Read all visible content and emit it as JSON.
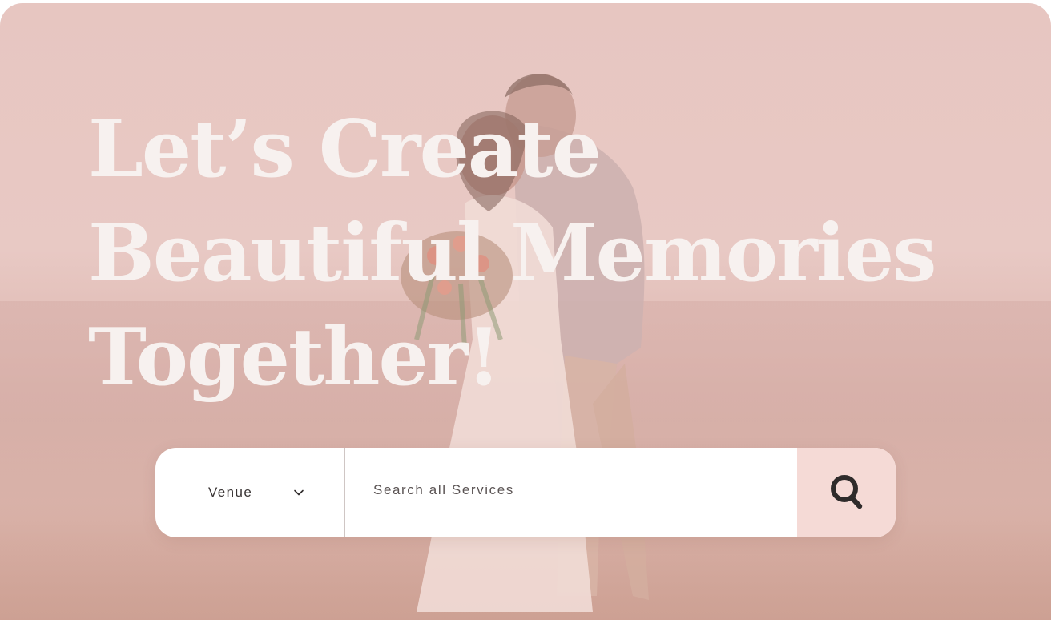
{
  "hero": {
    "headline_lines": [
      "Let’s Create",
      "Beautiful Memories",
      "Together!"
    ]
  },
  "search": {
    "category_value": "Venue",
    "placeholder": "Search all Services",
    "icons": {
      "dropdown": "chevron-down-icon",
      "submit": "search-icon"
    }
  },
  "colors": {
    "overlay_pink": "#e7c6c1",
    "headline_text": "#f7f1ef",
    "search_button_bg": "#f5dad6",
    "search_icon": "#2f2b2b"
  }
}
